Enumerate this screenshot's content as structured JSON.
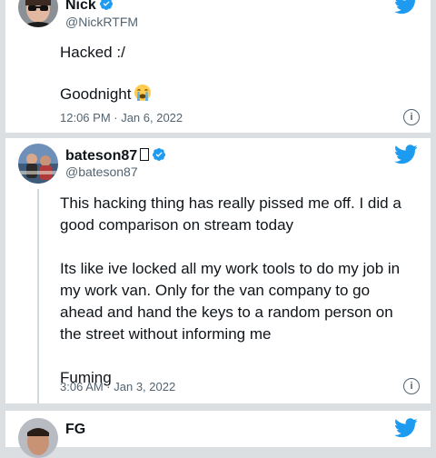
{
  "tweets": [
    {
      "name": "Nick",
      "handle": "@NickRTFM",
      "paragraphs": [
        "Hacked :/",
        "Goodnight"
      ],
      "timestamp": "12:06 PM · Jan 6, 2022"
    },
    {
      "name": "bateson87",
      "handle": "@bateson87",
      "paragraphs": [
        "This hacking thing has really pissed me off. I did a good comparison on stream today",
        "Its like ive locked all my work tools to do my job in my work van. Only for the van company to go ahead and hand the keys to a random person on the street without informing me",
        "Fuming"
      ],
      "timestamp": "3:06 AM · Jan 3, 2022"
    },
    {
      "name": "FG"
    }
  ],
  "icons": {
    "verified": "verified-badge-icon",
    "twitter": "twitter-bird-icon",
    "info": "info-icon",
    "emoji": "loudly-crying-face-emoji"
  },
  "colors": {
    "twitter_blue": "#1d9bf0",
    "text": "#0f1419",
    "secondary": "#536471"
  }
}
